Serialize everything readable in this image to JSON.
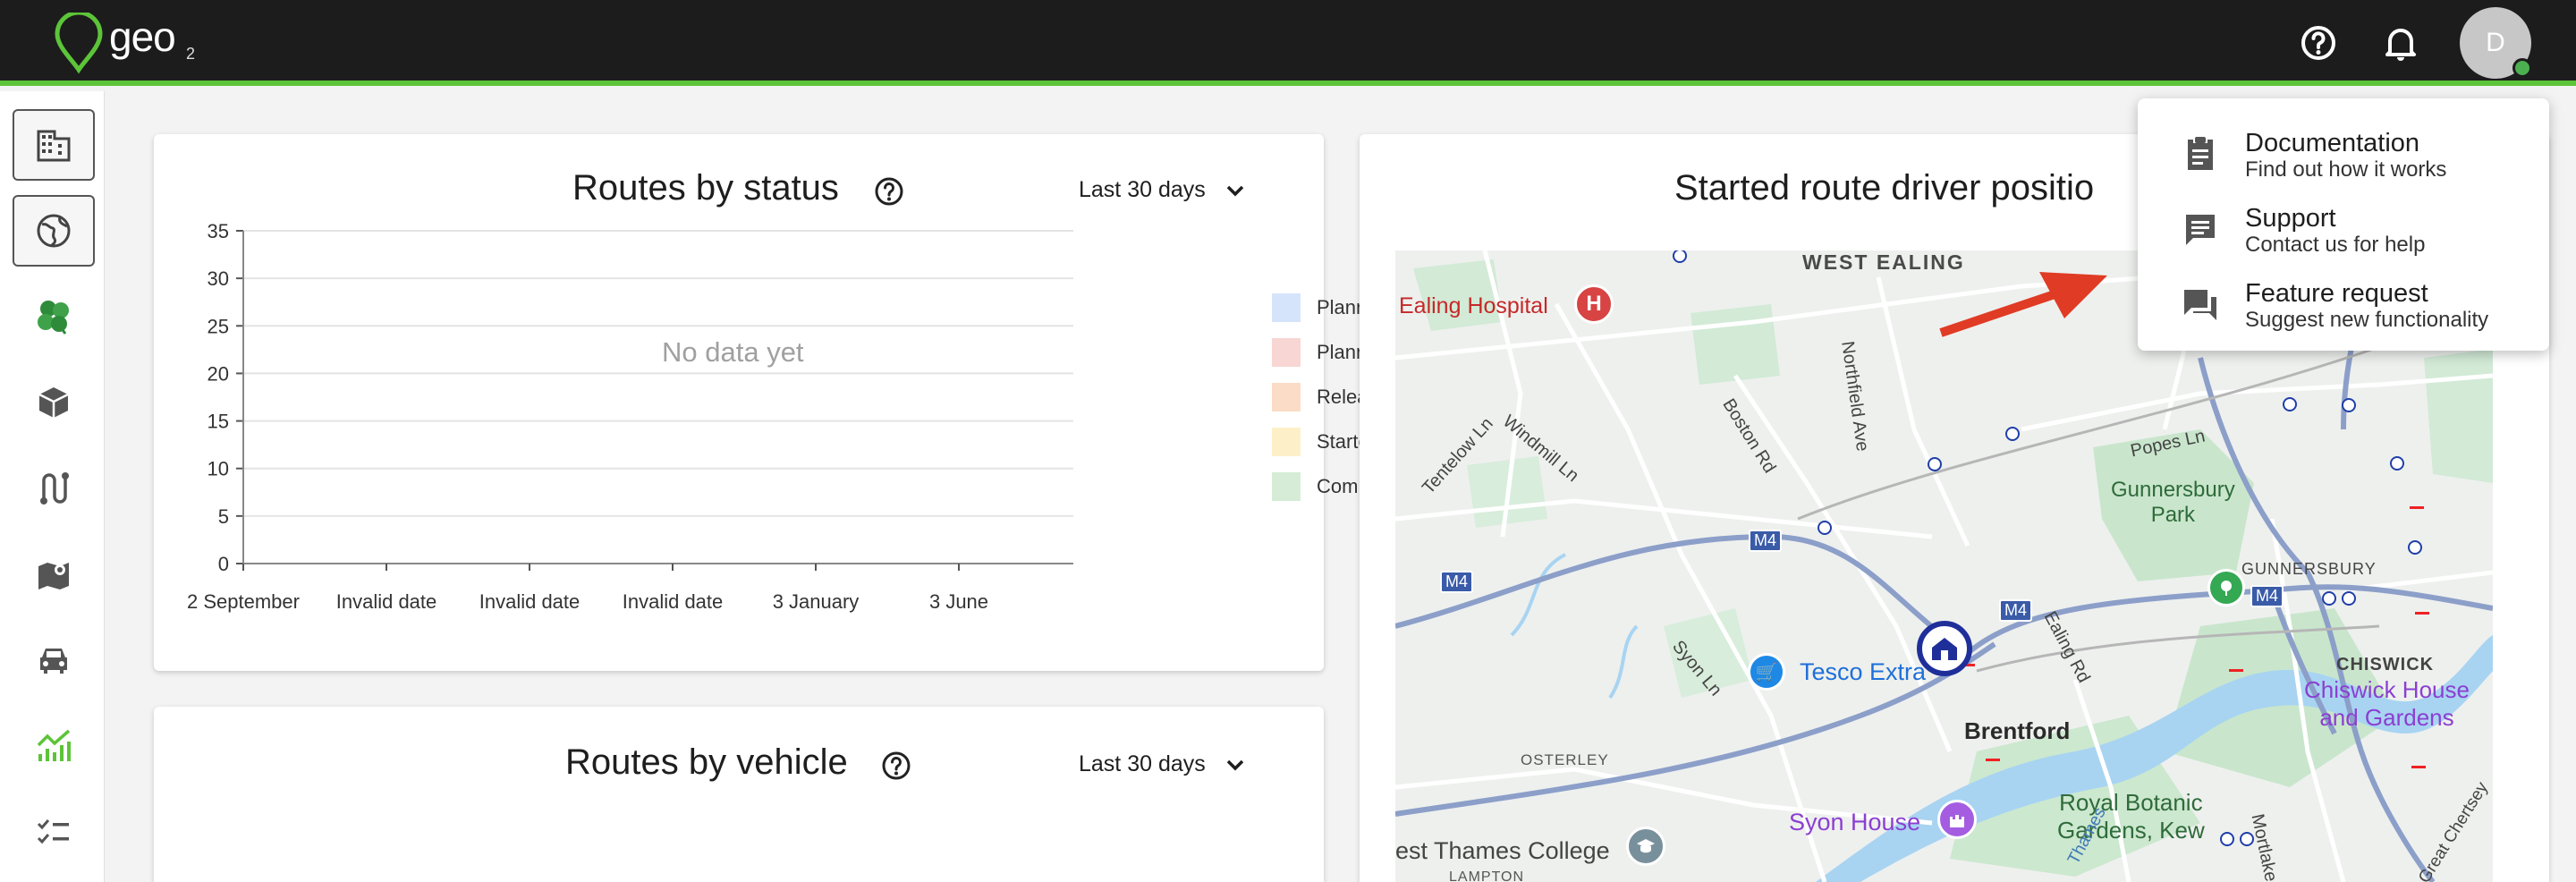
{
  "app": {
    "logo_text": "geo",
    "logo_sub": "2",
    "accent": "#5cc438",
    "user_initial": "D"
  },
  "header_icons": [
    "help-icon",
    "bell-icon"
  ],
  "sidebar": {
    "items": [
      {
        "name": "sidebar-item-buildings",
        "icon": "building-icon"
      },
      {
        "name": "sidebar-item-globe",
        "icon": "globe-icon"
      },
      {
        "name": "sidebar-item-clover",
        "icon": "clover-icon"
      },
      {
        "name": "sidebar-item-packages",
        "icon": "package-icon"
      },
      {
        "name": "sidebar-item-routes",
        "icon": "route-icon"
      },
      {
        "name": "sidebar-item-map",
        "icon": "map-icon"
      },
      {
        "name": "sidebar-item-vehicles",
        "icon": "car-icon"
      },
      {
        "name": "sidebar-item-analytics",
        "icon": "chart-icon"
      },
      {
        "name": "sidebar-item-tasks",
        "icon": "checklist-icon"
      }
    ]
  },
  "routes_by_status": {
    "title": "Routes by status",
    "range": "Last 30 days",
    "empty_message": "No data yet"
  },
  "routes_by_vehicle": {
    "title": "Routes by vehicle",
    "range": "Last 30 days"
  },
  "driver_positions": {
    "title": "Started route driver positio"
  },
  "chart_data": {
    "type": "bar",
    "title": "Routes by status",
    "categories": [
      "2 September",
      "Invalid date",
      "Invalid date",
      "Invalid date",
      "3 January",
      "3 June"
    ],
    "yticks": [
      "0",
      "5",
      "10",
      "15",
      "20",
      "25",
      "30",
      "35"
    ],
    "ylim": [
      0,
      35
    ],
    "grid": true,
    "legend_position": "right",
    "series": [
      {
        "name": "Planning",
        "color": "#d6e4fb",
        "values": []
      },
      {
        "name": "Planned",
        "color": "#f8d6d3",
        "values": []
      },
      {
        "name": "Released",
        "color": "#fbdcc6",
        "values": []
      },
      {
        "name": "Started",
        "color": "#fdf0c9",
        "values": []
      },
      {
        "name": "Completed",
        "color": "#d6ecd6",
        "values": []
      }
    ]
  },
  "map": {
    "labels": {
      "west_ealing": "WEST EALING",
      "ealing_hospital": "Ealing Hospital",
      "northfield_ave": "Northfield Ave",
      "boston_rd": "Boston Rd",
      "windmill_ln": "Windmill Ln",
      "tentelow_ln": "Tentelow Ln",
      "popes_ln": "Popes Ln",
      "gunnersbury_park": "Gunnersbury\nPark",
      "gunnersbury": "GUNNERSBURY",
      "chiswick": "CHISWICK",
      "chiswick_house": "Chiswick House\nand Gardens",
      "m4_1": "M4",
      "m4_2": "M4",
      "m4_3": "M4",
      "m4_4": "M4",
      "syon_ln": "Syon Ln",
      "tesco": "Tesco Extra",
      "ealing_rd": "Ealing Rd",
      "brentford": "Brentford",
      "osterley": "OSTERLEY",
      "syon_house": "Syon House",
      "kew": "Royal Botanic\nGardens, Kew",
      "west_thames": "est Thames College",
      "lampton": "LAMPTON",
      "mortlake": "Mortlake",
      "thames": "Thames",
      "great_chertsey": "Great Chertsey"
    }
  },
  "help_menu": {
    "items": [
      {
        "title": "Documentation",
        "subtitle": "Find out how it works",
        "icon": "clipboard-icon"
      },
      {
        "title": "Support",
        "subtitle": "Contact us for help",
        "icon": "chat-icon"
      },
      {
        "title": "Feature request",
        "subtitle": "Suggest new functionality",
        "icon": "forum-icon"
      }
    ]
  }
}
